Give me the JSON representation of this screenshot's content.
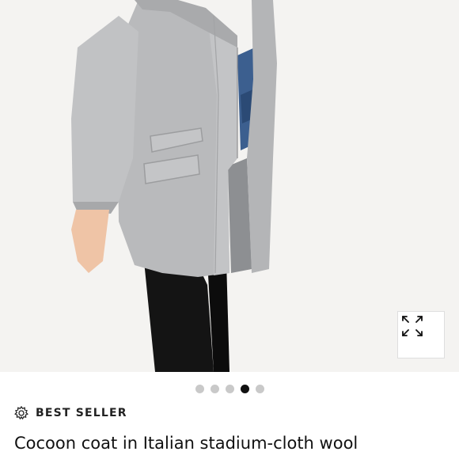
{
  "product": {
    "badge_icon": "starburst-badge-icon",
    "badge_label": "BEST SELLER",
    "title": "Cocoon coat in Italian stadium-cloth wool"
  },
  "gallery": {
    "image_count": 5,
    "active_index": 3,
    "expand_icon": "expand-arrows-icon",
    "accent_active_dot": "#111111",
    "inactive_dot": "#c9c9c9"
  }
}
